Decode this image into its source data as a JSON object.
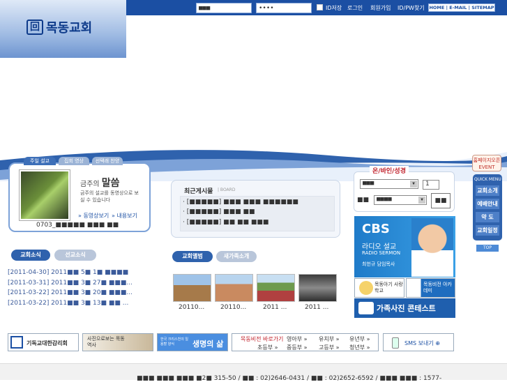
{
  "header": {
    "logo_symbol": "回",
    "logo_text": "목동교회",
    "login_id_value": "■■■",
    "login_pw_value": "••••",
    "remember_label": "ID저장",
    "login_label": "로그인",
    "join_label": "회원가입",
    "find_label": "ID/PW찾기",
    "top_links": "HOME | E-MAIL | SITEMAP"
  },
  "sermon": {
    "tabs": [
      "주일 설교",
      "집회 영상",
      "선택래 찬양"
    ],
    "title_prefix": "금주의 ",
    "title_main": "말씀",
    "description": "금주의 설교를 동영상으로 보실 수 있습니다",
    "video_link": "» 동영상보기",
    "content_link": "» 내용보기",
    "date": "0703_■■■■■ ■■■ ■■"
  },
  "news": {
    "tabs": [
      "교회소식",
      "선교소식"
    ],
    "items": [
      "[2011-04-30] 2011■■ 5■ 1■ ■■■■",
      "[2011-03-31] 2011■■ 3■ 27■ ■■■...",
      "[2011-03-22] 2011■■ 3■ 20■ ■■■...",
      "[2011-03-22] 2011■■ 3■ 13■ ■■ ..."
    ]
  },
  "board": {
    "title": "최근게시물",
    "subtitle": "| BOARD",
    "items": [
      "· [■■■■■] ■■■ ■■■ ■■■■■■",
      "· [■■■■■] ■■■ ■■",
      "· [■■■■■] ■■ ■■ ■■■"
    ]
  },
  "album": {
    "tabs": [
      "교회앨범",
      "새가족소개"
    ],
    "captions": [
      "20110...",
      "20110...",
      "2011 ...",
      "2011 ..."
    ]
  },
  "bible": {
    "title": "온/바인/성경",
    "book_value": "■■■",
    "chapter_value": "1",
    "verse_label": "■■",
    "version_value": "■■■■",
    "go_label": "■■"
  },
  "cbs": {
    "logo": "CBS",
    "radio": "라디오 설교",
    "en": "RADIO SERMON",
    "pastor": "최헌규 담임목사"
  },
  "promos": {
    "love_school": "목동아기 사랑학교",
    "academy": "목동비전 아카데미",
    "family_concert": "가족사진 콘테스트"
  },
  "quick_menu": {
    "event": "홈페이지오픈 EVENT",
    "title": "QUICK MENU",
    "items": [
      "교회소개",
      "예배안내",
      "약 도",
      "교회일정"
    ],
    "top": "TOP"
  },
  "banners": {
    "kmc": "기독교대한감리회",
    "history": "사진으로보는 목동역사",
    "life_small": "한국 크리스천의 일용할 양식",
    "life_big": "생명의 삶",
    "depts_title": "목동비전 바로가기",
    "depts": [
      "영아부 »",
      "유치부 »",
      "유년부 »",
      "초등부 »",
      "중등부 »",
      "고등부 »",
      "청년부 »"
    ],
    "sms": "SMS 보내기 ⊕"
  },
  "footer": {
    "text": "■■■ ■■■ ■■■ ■2■ 315-50 / ■■ : 02)2646-0431 / ■■ : 02)2652-6592 / ■■■ ■■■ : 1577-"
  },
  "colors": {
    "primary": "#1b4fa3",
    "accent_red": "#c0202a",
    "cbs_blue": "#1f7bc9"
  }
}
